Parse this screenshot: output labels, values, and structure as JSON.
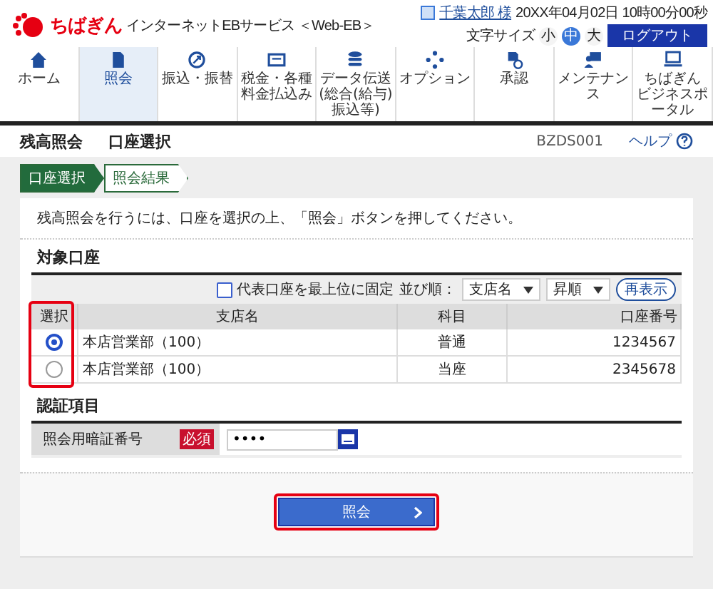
{
  "header": {
    "brand": "ちばぎん",
    "service": "インターネットEBサービス ＜Web-EB＞",
    "user": "千葉太郎 様",
    "datetime": "20XX年04月02日 10時00分00秒",
    "font_size_label": "文字サイズ",
    "font_sizes": [
      {
        "label": "小",
        "selected": false
      },
      {
        "label": "中",
        "selected": true
      },
      {
        "label": "大",
        "selected": false
      }
    ],
    "logout": "ログアウト"
  },
  "nav": [
    {
      "label": "ホーム",
      "selected": false
    },
    {
      "label": "照会",
      "selected": true
    },
    {
      "label": "振込・振替",
      "selected": false
    },
    {
      "label": "税金・各種料金払込み",
      "selected": false
    },
    {
      "label": "データ伝送",
      "sub": "(総合(給与)振込等)",
      "selected": false
    },
    {
      "label": "オプション",
      "selected": false
    },
    {
      "label": "承認",
      "selected": false
    },
    {
      "label": "メンテナンス",
      "selected": false
    },
    {
      "label": "ちばぎん",
      "sub": "ビジネスポータル",
      "selected": false
    }
  ],
  "page": {
    "title": "残高照会",
    "subtitle": "口座選択",
    "screen_id": "BZDS001",
    "help": "ヘルプ"
  },
  "steps": [
    {
      "label": "口座選択",
      "selected": true
    },
    {
      "label": "照会結果",
      "selected": false
    }
  ],
  "instruction": "残高照会を行うには、口座を選択の上、「照会」ボタンを押してください。",
  "accounts": {
    "title": "対象口座",
    "pin_top": {
      "label": "代表口座を最上位に固定",
      "checked": false
    },
    "sort_label": "並び順：",
    "sort_key": "支店名",
    "sort_order": "昇順",
    "refresh": "再表示",
    "columns": [
      "選択",
      "支店名",
      "科目",
      "口座番号"
    ],
    "rows": [
      {
        "selected": true,
        "branch": "本店営業部（100）",
        "subject": "普通",
        "number": "1234567"
      },
      {
        "selected": false,
        "branch": "本店営業部（100）",
        "subject": "当座",
        "number": "2345678"
      }
    ]
  },
  "auth": {
    "title": "認証項目",
    "label": "照会用暗証番号",
    "required": "必須",
    "value": "••••"
  },
  "submit": "照会"
}
